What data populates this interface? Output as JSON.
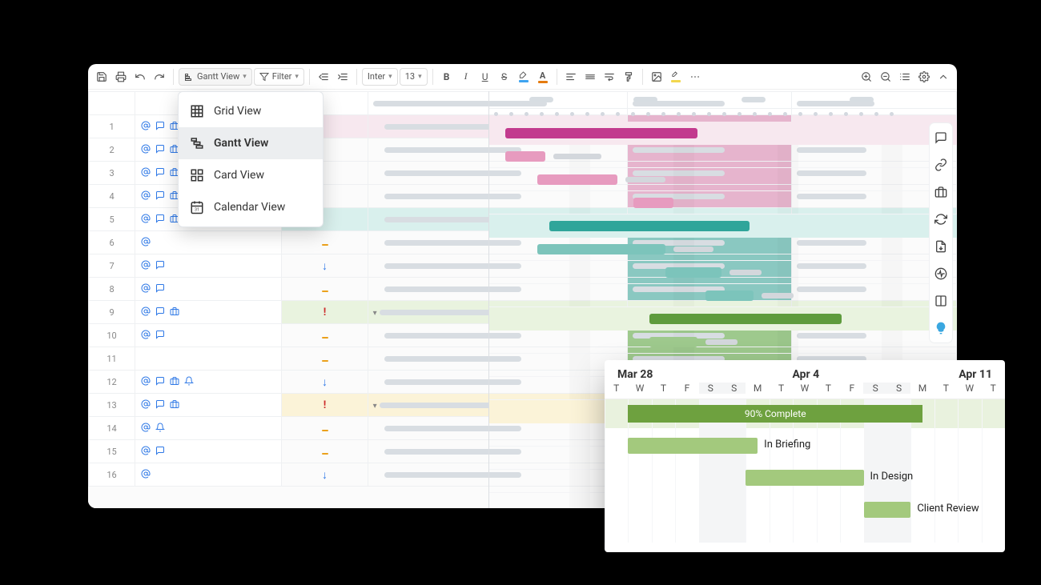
{
  "toolbar": {
    "view_selector_label": "Gantt View",
    "filter_label": "Filter",
    "font_name": "Inter",
    "font_size": "13"
  },
  "view_dropdown": {
    "items": [
      {
        "label": "Grid View"
      },
      {
        "label": "Gantt View"
      },
      {
        "label": "Card View"
      },
      {
        "label": "Calendar View"
      }
    ]
  },
  "rows": [
    {
      "num": "1",
      "icons": [
        "at",
        "chat",
        "brief"
      ],
      "tint": "pink"
    },
    {
      "num": "2",
      "icons": [
        "at",
        "chat",
        "brief"
      ]
    },
    {
      "num": "3",
      "icons": [
        "at",
        "chat",
        "brief"
      ]
    },
    {
      "num": "4",
      "icons": [
        "at",
        "chat",
        "brief"
      ]
    },
    {
      "num": "5",
      "icons": [
        "at",
        "chat",
        "brief"
      ],
      "tint": "teal"
    },
    {
      "num": "6",
      "icons": [
        "at"
      ],
      "prio": "dash"
    },
    {
      "num": "7",
      "icons": [
        "at",
        "chat"
      ],
      "prio": "down"
    },
    {
      "num": "8",
      "icons": [
        "at",
        "chat"
      ],
      "prio": "dash"
    },
    {
      "num": "9",
      "icons": [
        "at",
        "chat",
        "brief"
      ],
      "prio": "bang",
      "tint": "green",
      "parent": true
    },
    {
      "num": "10",
      "icons": [
        "at",
        "chat"
      ],
      "prio": "dash"
    },
    {
      "num": "11",
      "icons": [],
      "prio": "dash"
    },
    {
      "num": "12",
      "icons": [
        "at",
        "chat",
        "brief",
        "bell"
      ],
      "prio": "down"
    },
    {
      "num": "13",
      "icons": [
        "at",
        "chat",
        "brief"
      ],
      "prio": "bang",
      "tint": "yellow",
      "parent": true
    },
    {
      "num": "14",
      "icons": [
        "at",
        "bell2"
      ],
      "prio": "dash"
    },
    {
      "num": "15",
      "icons": [
        "at",
        "chat"
      ],
      "prio": "dash"
    },
    {
      "num": "16",
      "icons": [
        "at"
      ],
      "prio": "down"
    }
  ],
  "detail": {
    "months": [
      "Mar 28",
      "Apr 4",
      "Apr 11"
    ],
    "weekdays": [
      "T",
      "W",
      "T",
      "F",
      "S",
      "S",
      "M",
      "T",
      "W",
      "T",
      "F",
      "S",
      "S",
      "M",
      "T",
      "W",
      "T"
    ],
    "parent_label": "90% Complete",
    "items": [
      {
        "label": "In Briefing"
      },
      {
        "label": "In Design"
      },
      {
        "label": "Client Review"
      }
    ]
  }
}
